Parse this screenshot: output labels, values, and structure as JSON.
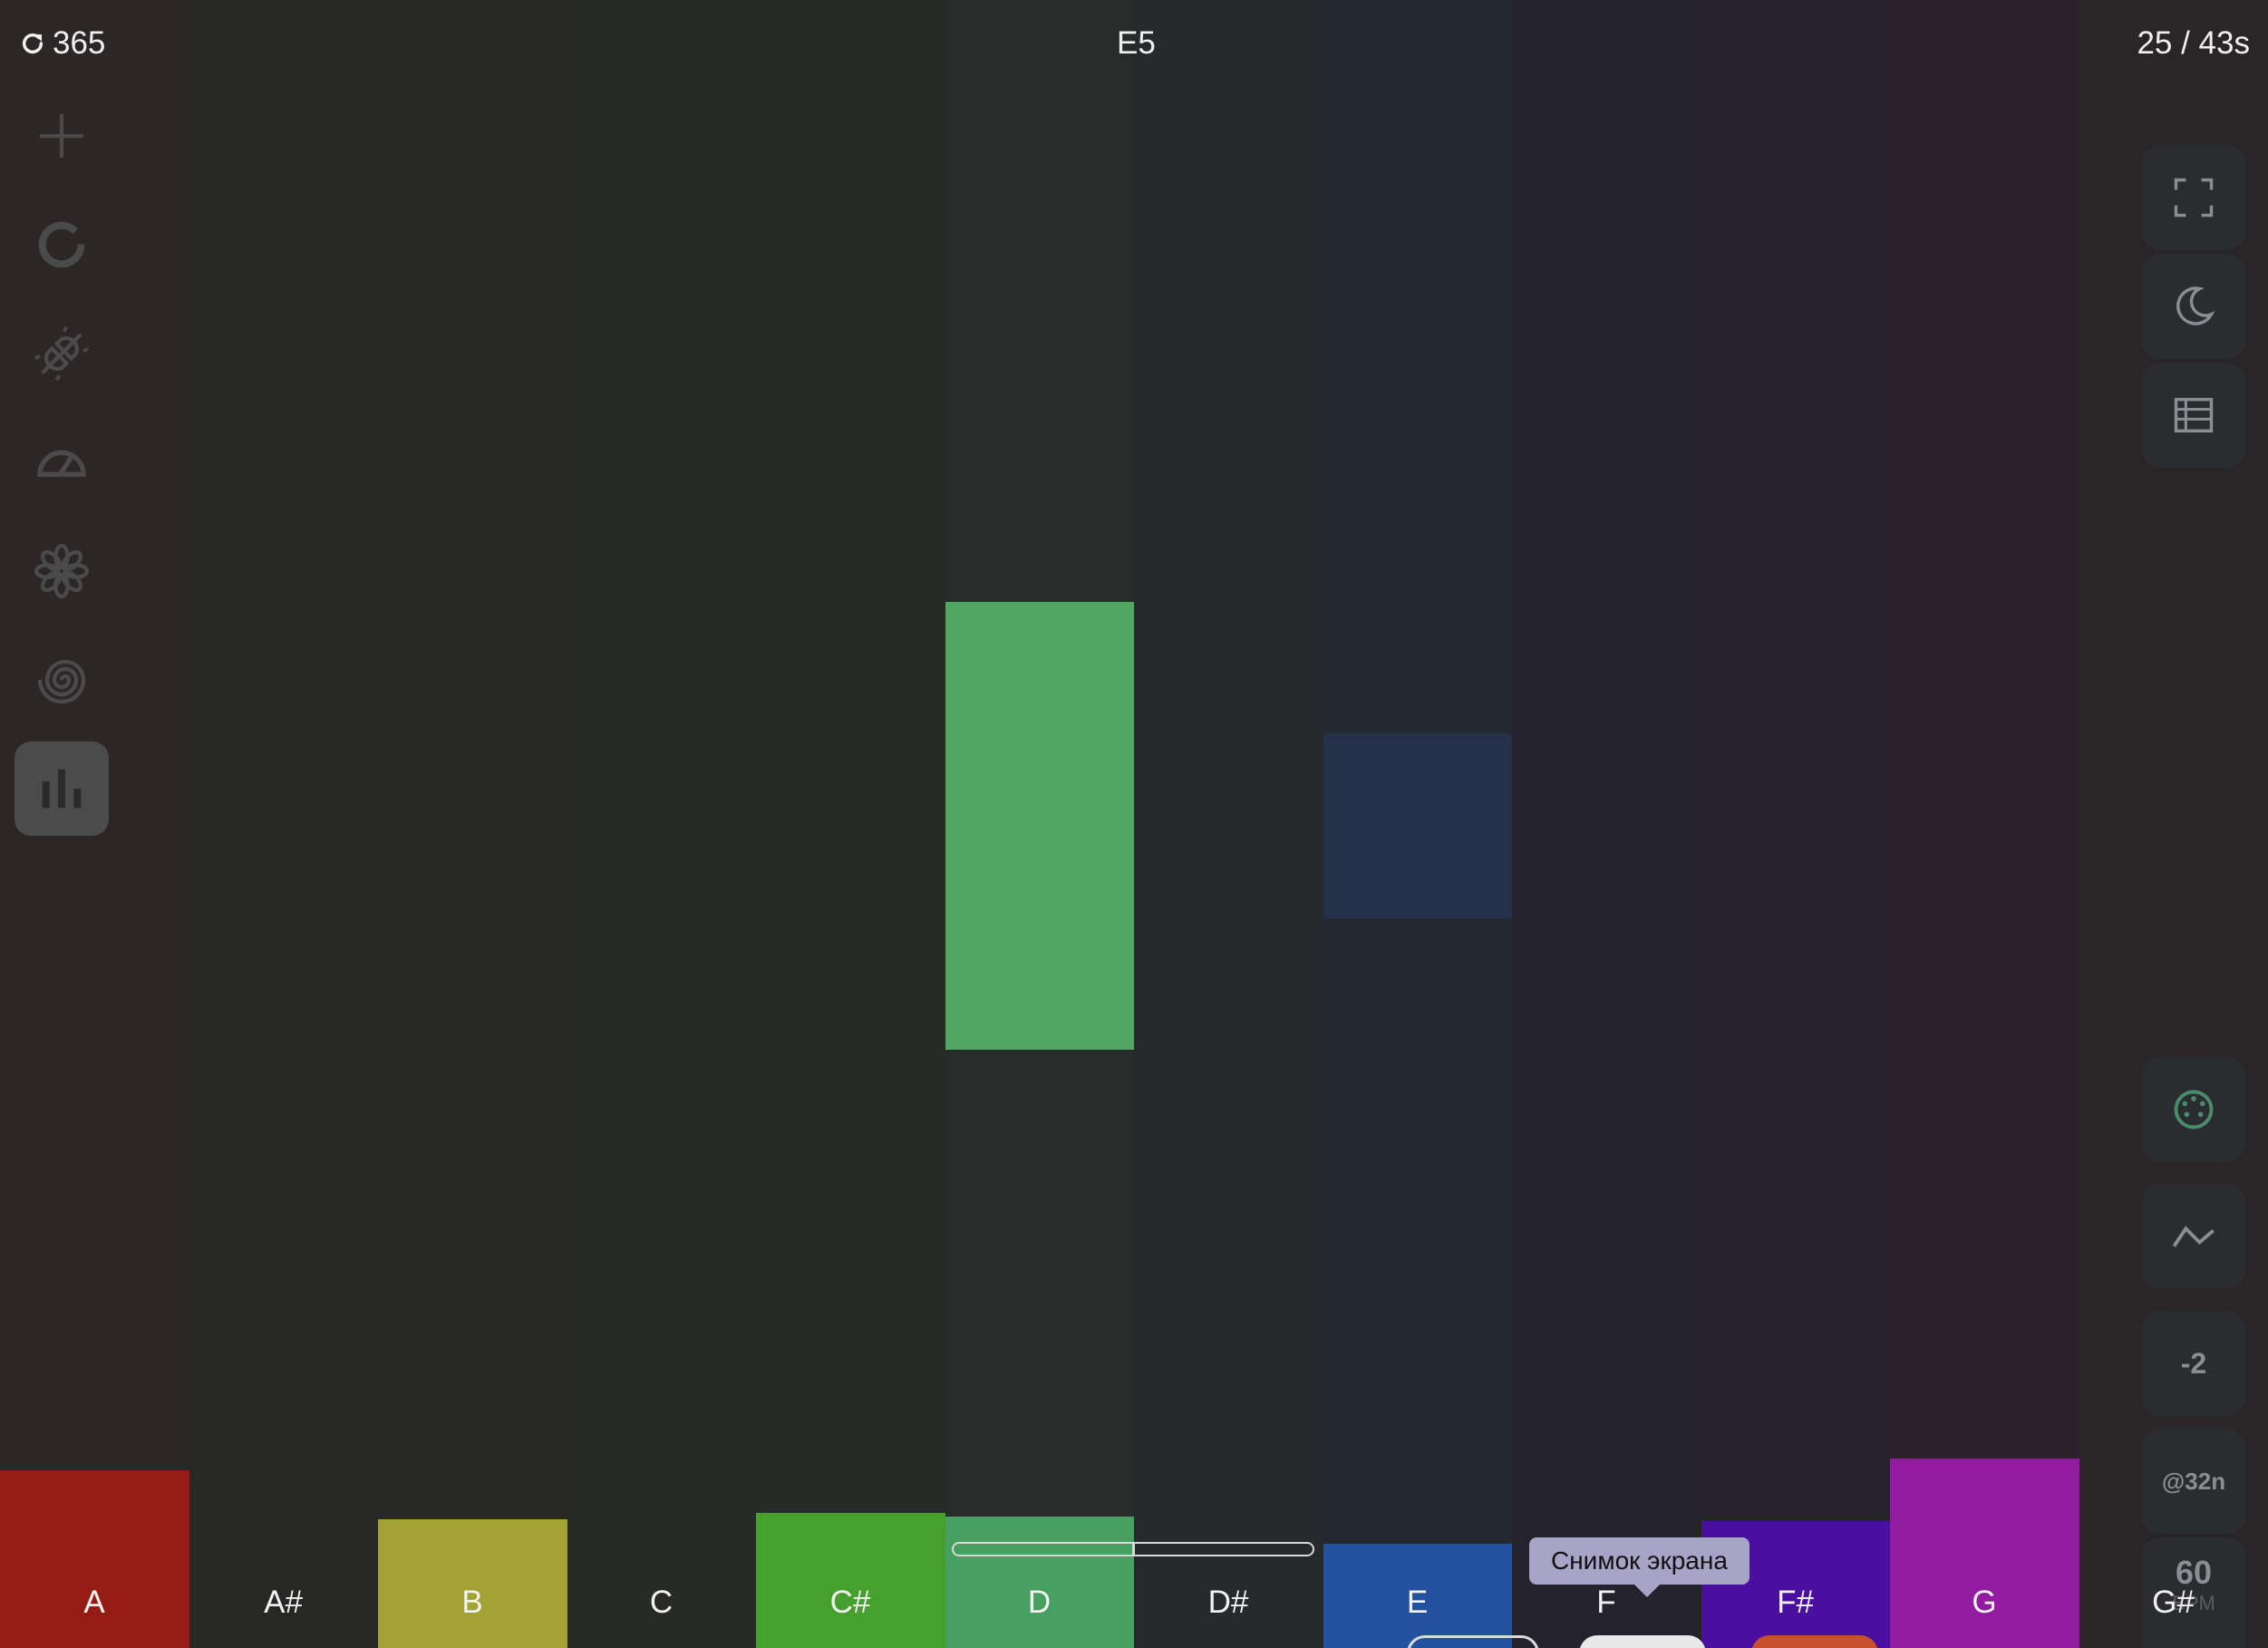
{
  "header": {
    "counter": "365",
    "current_note": "E5",
    "timer": "25 / 43s"
  },
  "notes": [
    {
      "label": "A",
      "col_color": "#2d2627",
      "bar_color": "#951c13",
      "level": 0.108
    },
    {
      "label": "A#",
      "col_color": "#272825",
      "bar_color": "#272825",
      "level": 0
    },
    {
      "label": "B",
      "col_color": "#282927",
      "bar_color": "#a3a235",
      "level": 0.078
    },
    {
      "label": "C",
      "col_color": "#272a26",
      "bar_color": "#272a26",
      "level": 0
    },
    {
      "label": "C#",
      "col_color": "#262b26",
      "bar_color": "#46a02e",
      "level": 0.082
    },
    {
      "label": "D",
      "col_color": "#272b29",
      "bar_color": "#47a060",
      "level": 0.08
    },
    {
      "label": "D#",
      "col_color": "#262a2c",
      "bar_color": "#262a2c",
      "level": 0
    },
    {
      "label": "E",
      "col_color": "#242830",
      "bar_color": "#2251a0",
      "level": 0.063
    },
    {
      "label": "F",
      "col_color": "#24232d",
      "bar_color": "#24232d",
      "level": 0
    },
    {
      "label": "F#",
      "col_color": "#25212d",
      "bar_color": "#4a0ea0",
      "level": 0.077
    },
    {
      "label": "G",
      "col_color": "#2c202c",
      "bar_color": "#921ca0",
      "level": 0.115
    },
    {
      "label": "G#",
      "col_color": "#2a2526",
      "bar_color": "#2a2526",
      "level": 0
    }
  ],
  "floating_blocks": [
    {
      "note": "D",
      "color": "#51a663"
    },
    {
      "note": "E",
      "color": "#25304b"
    }
  ],
  "left_toolbar": [
    {
      "name": "add-icon",
      "active": false
    },
    {
      "name": "loop-icon",
      "active": false
    },
    {
      "name": "disconnect-icon",
      "active": false
    },
    {
      "name": "speedometer-icon",
      "active": false
    },
    {
      "name": "flower-icon",
      "active": false
    },
    {
      "name": "spiral-icon",
      "active": false
    },
    {
      "name": "bar-chart-icon",
      "active": true
    }
  ],
  "right_toolbar": {
    "fullscreen_icon": "fullscreen-icon",
    "theme_icon": "moon-icon",
    "layout_icon": "layout-icon",
    "midi_icon": "midi-icon",
    "wave_icon": "wave-icon",
    "transpose": "-2",
    "quantize": "@32n",
    "bpm_value": "60",
    "bpm_unit": "BPM"
  },
  "progress": 0.5,
  "tooltip": "Снимок экрана",
  "colors": {
    "icon": "#4a4a4a",
    "active_bg": "#4b4b4b",
    "right_icon": "#8a8d92",
    "midi_icon": "#4a8c6a"
  }
}
